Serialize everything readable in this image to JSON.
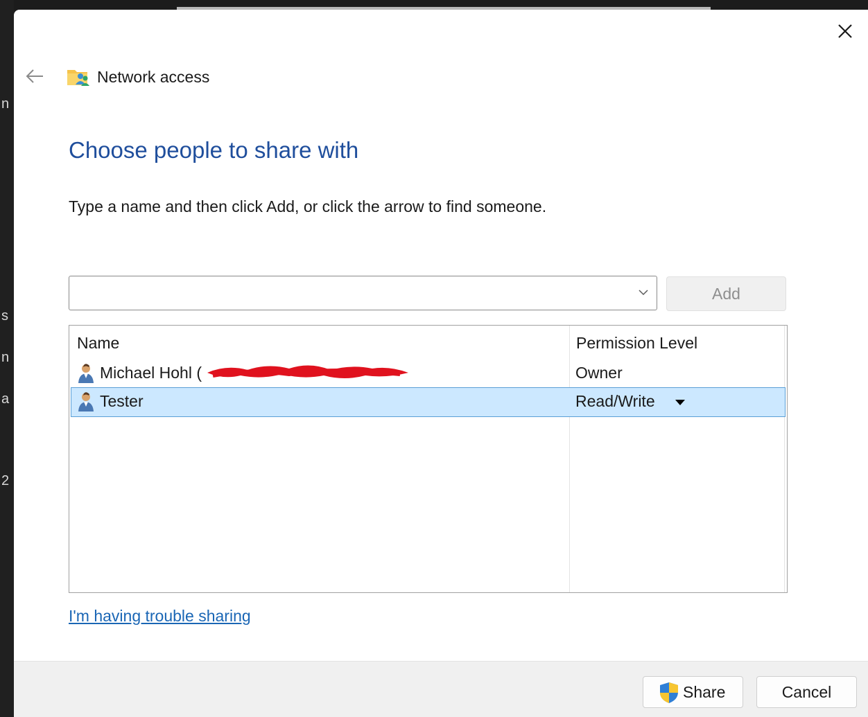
{
  "window": {
    "title": "Network access"
  },
  "main": {
    "heading": "Choose people to share with",
    "instruction": "Type a name and then click Add, or click the arrow to find someone.",
    "name_input": {
      "value": "",
      "placeholder": ""
    },
    "add_button": "Add"
  },
  "table": {
    "columns": [
      "Name",
      "Permission Level"
    ],
    "rows": [
      {
        "name": "Michael Hohl (",
        "permission": "Owner",
        "selected": false
      },
      {
        "name": "Tester",
        "permission": "Read/Write",
        "selected": true
      }
    ]
  },
  "trouble_link": "I'm having trouble sharing",
  "footer": {
    "share_button": "Share",
    "cancel_button": "Cancel"
  },
  "colors": {
    "heading": "#1f4e9c",
    "link": "#1a66b5",
    "selection": "#cce8ff",
    "selection_border": "#5a9fd6"
  },
  "icons": [
    "close-icon",
    "back-arrow-icon",
    "network-folder-icon",
    "chevron-down-icon",
    "user-icon",
    "dropdown-triangle-icon",
    "uac-shield-icon"
  ]
}
